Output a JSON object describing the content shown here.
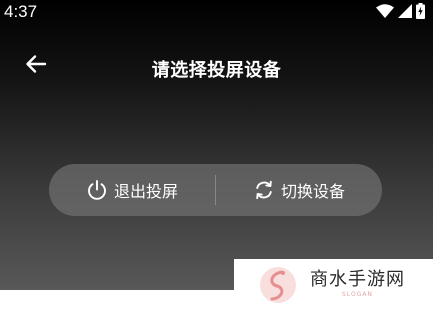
{
  "status_bar": {
    "time": "4:37",
    "icons": [
      "wifi-icon",
      "cellular-signal-icon",
      "battery-charging-icon"
    ]
  },
  "header": {
    "back_icon": "arrow-left-icon",
    "title": "请选择投屏设备"
  },
  "controls": {
    "exit": {
      "icon": "power-icon",
      "label": "退出投屏"
    },
    "switch": {
      "icon": "refresh-icon",
      "label": "切换设备"
    }
  },
  "watermark": {
    "text": "商水手游网",
    "slogan": "SLOGAN"
  },
  "colors": {
    "background_top": "#000000",
    "background_bottom": "#585858",
    "pill": "#6e6e6e",
    "text": "#ffffff",
    "watermark_accent": "#e58f8f"
  }
}
